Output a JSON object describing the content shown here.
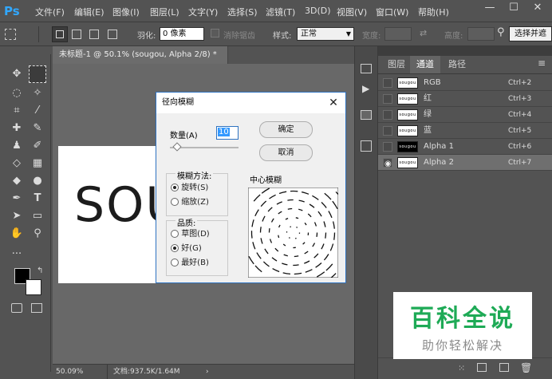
{
  "app": {
    "logo": "Ps"
  },
  "menu": [
    "文件(F)",
    "编辑(E)",
    "图像(I)",
    "图层(L)",
    "文字(Y)",
    "选择(S)",
    "滤镜(T)",
    "3D(D)",
    "视图(V)",
    "窗口(W)",
    "帮助(H)"
  ],
  "window_controls": {
    "minimize": "—",
    "maximize": "☐",
    "close": "✕"
  },
  "options": {
    "feather_label": "羽化:",
    "feather_value": "0 像素",
    "antialias_label": "消除锯齿",
    "style_label": "样式:",
    "style_value": "正常",
    "width_label": "宽度:",
    "height_label": "高度:",
    "select_mask_button": "选择并遮"
  },
  "document": {
    "tab_title": "未标题-1 @ 50.1% (sougou, Alpha 2/8) *",
    "canvas_text": "SOU",
    "zoom": "50.09%",
    "doc_info": "文档:937.5K/1.64M"
  },
  "panel": {
    "tabs": [
      "图层",
      "通道",
      "路径"
    ],
    "active_tab": "通道",
    "channels": [
      {
        "thumb": "sougou",
        "name": "RGB",
        "shortcut": "Ctrl+2",
        "visible": false,
        "dark": false,
        "selected": false
      },
      {
        "thumb": "sougou",
        "name": "红",
        "shortcut": "Ctrl+3",
        "visible": false,
        "dark": false,
        "selected": false
      },
      {
        "thumb": "sougou",
        "name": "绿",
        "shortcut": "Ctrl+4",
        "visible": false,
        "dark": false,
        "selected": false
      },
      {
        "thumb": "sougou",
        "name": "蓝",
        "shortcut": "Ctrl+5",
        "visible": false,
        "dark": false,
        "selected": false
      },
      {
        "thumb": "sougou",
        "name": "Alpha 1",
        "shortcut": "Ctrl+6",
        "visible": false,
        "dark": true,
        "selected": false
      },
      {
        "thumb": "sougou",
        "name": "Alpha 2",
        "shortcut": "Ctrl+7",
        "visible": true,
        "dark": false,
        "selected": true
      }
    ]
  },
  "dialog": {
    "title": "径向模糊",
    "amount_label": "数量(A)",
    "amount_value": "10",
    "amount_fraction": 0.1,
    "ok_button": "确定",
    "cancel_button": "取消",
    "method_label": "模糊方法:",
    "methods": [
      {
        "label": "旋转(S)",
        "selected": true
      },
      {
        "label": "缩放(Z)",
        "selected": false
      }
    ],
    "quality_label": "品质:",
    "qualities": [
      {
        "label": "草图(D)",
        "selected": false
      },
      {
        "label": "好(G)",
        "selected": true
      },
      {
        "label": "最好(B)",
        "selected": false
      }
    ],
    "center_label": "中心模糊"
  },
  "watermark": {
    "title": "百科全说",
    "subtitle": "助你轻松解决"
  },
  "colors": {
    "accent": "#31a8ff",
    "dialog_border": "#2f73c1",
    "watermark_green": "#1eaa56",
    "selected_row": "#6f6f6f"
  }
}
